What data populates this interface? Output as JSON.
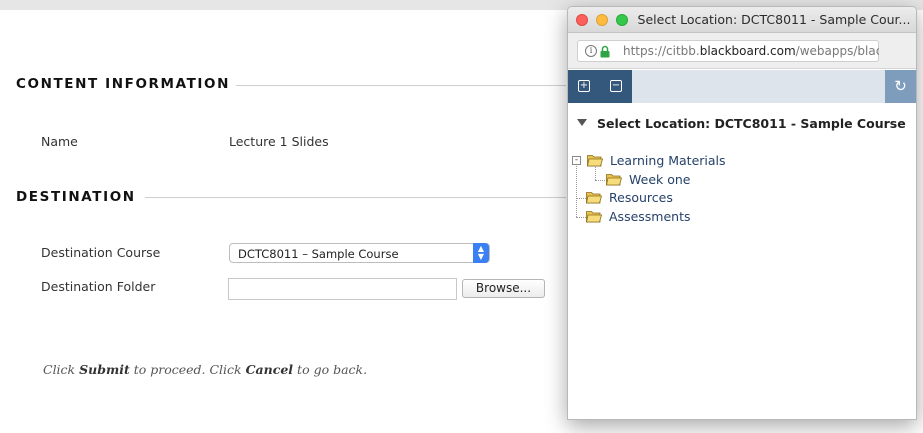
{
  "content_section": {
    "title": "CONTENT INFORMATION",
    "name_label": "Name",
    "name_value": "Lecture 1 Slides"
  },
  "destination_section": {
    "title": "DESTINATION",
    "course_label": "Destination Course",
    "course_value": "DCTC8011 – Sample Course",
    "folder_label": "Destination Folder",
    "folder_value": "",
    "browse_label": "Browse..."
  },
  "instructions": {
    "pre": "Click",
    "submit": "Submit",
    "mid": "to proceed. Click",
    "cancel": "Cancel",
    "post": "to go back."
  },
  "popup": {
    "window_title": "Select Location: DCTC8011 - Sample Cour...",
    "url_prefix": "https://citbb.",
    "url_host": "blackboard.com",
    "url_path": "/webapps/blac",
    "heading": "Select Location: DCTC8011 - Sample Course",
    "tree": {
      "learning_materials": "Learning Materials",
      "week_one": "Week one",
      "resources": "Resources",
      "assessments": "Assessments"
    },
    "icons": {
      "expand_all": "plus-square-icon",
      "collapse_all": "minus-square-icon",
      "refresh": "refresh-icon",
      "info": "info-icon",
      "lock": "lock-icon"
    },
    "colors": {
      "toolbar_dark": "#34577c",
      "toolbar_light": "#dde4ec",
      "folder": "#f3d56a",
      "link": "#26416b"
    }
  }
}
